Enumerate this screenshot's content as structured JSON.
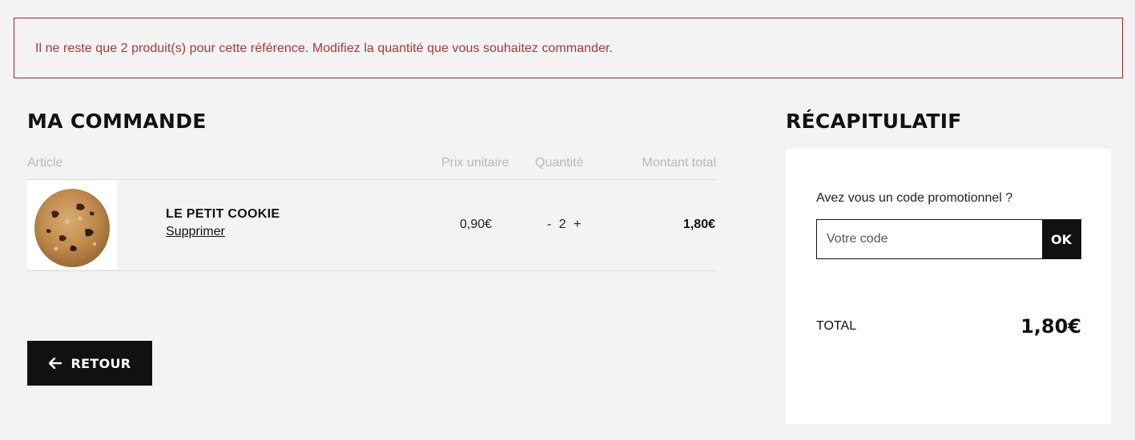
{
  "alert": {
    "message": "Il ne reste que 2 produit(s) pour cette référence. Modifiez la quantité que vous souhaitez commander."
  },
  "order": {
    "title": "MA COMMANDE",
    "columns": {
      "article": "Article",
      "unit_price": "Prix unitaire",
      "quantity": "Quantité",
      "total": "Montant total"
    },
    "items": [
      {
        "name": "LE PETIT COOKIE",
        "remove_label": "Supprimer",
        "unit_price": "0,90€",
        "qty_minus": "-",
        "quantity": "2",
        "qty_plus": "+",
        "line_total": "1,80€",
        "image": "cookie-image"
      }
    ],
    "back_button": {
      "label": "RETOUR",
      "icon": "arrow-left-icon"
    }
  },
  "summary": {
    "title": "RÉCAPITULATIF",
    "promo_label": "Avez vous un code promotionnel ?",
    "promo_placeholder": "Votre code",
    "promo_button": "OK",
    "total_label": "TOTAL",
    "total_value": "1,80€"
  },
  "colors": {
    "alert_border": "#9b2a2a",
    "alert_text": "#a33a3a",
    "background": "#f3f3f3",
    "button_bg": "#111111"
  }
}
